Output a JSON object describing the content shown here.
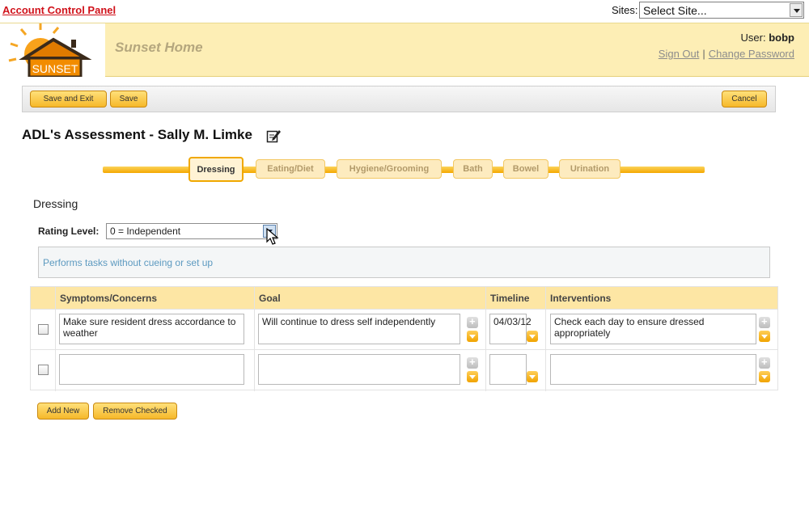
{
  "topbar": {
    "account_link": "Account Control Panel",
    "sites_label": "Sites:",
    "sites_value": "Select Site..."
  },
  "header": {
    "logo_text": "SUNSET",
    "app_name": "Sunset Home",
    "user_label": "User:",
    "user_name": "bobp",
    "sign_out": "Sign Out",
    "separator": "|",
    "change_password": "Change Password"
  },
  "toolbar": {
    "save_exit": "Save  and Exit",
    "save": "Save",
    "cancel": "Cancel"
  },
  "page": {
    "title": "ADL's Assessment - Sally M. Limke"
  },
  "tabs": [
    {
      "label": "Dressing",
      "active": true
    },
    {
      "label": "Eating/Diet",
      "active": false
    },
    {
      "label": "Hygiene/Grooming",
      "active": false
    },
    {
      "label": "Bath",
      "active": false
    },
    {
      "label": "Bowel",
      "active": false
    },
    {
      "label": "Urination",
      "active": false
    }
  ],
  "section": {
    "title": "Dressing",
    "rating_label": "Rating Level:",
    "rating_value": "0 = Independent",
    "description": "Performs tasks without cueing or set up"
  },
  "table": {
    "headers": {
      "symptoms": "Symptoms/Concerns",
      "goal": "Goal",
      "timeline": "Timeline",
      "interventions": "Interventions"
    },
    "rows": [
      {
        "symptoms": "Make sure resident dress accordance to weather",
        "goal": "Will continue to dress self independently",
        "timeline": "04/03/12",
        "interventions": "Check each day to ensure dressed appropriately"
      },
      {
        "symptoms": "",
        "goal": "",
        "timeline": "",
        "interventions": ""
      }
    ]
  },
  "footer_buttons": {
    "add_new": "Add New",
    "remove_checked": "Remove Checked"
  },
  "colors": {
    "accent": "#f6b82a",
    "banner": "#fdeeb5",
    "link_red": "#d0111a"
  }
}
